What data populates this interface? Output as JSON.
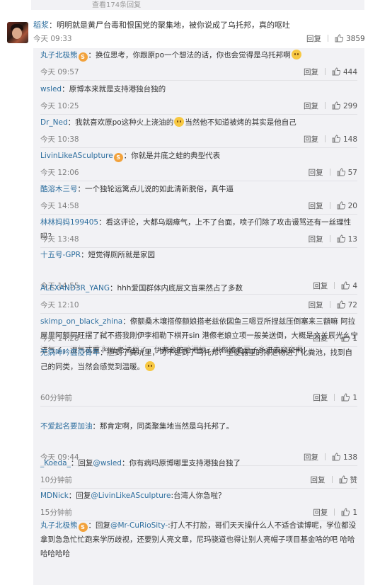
{
  "header": {
    "more_replies": "查看174条回复"
  },
  "main_comment": {
    "username": "稻浆",
    "text": "：明明就是黄尸台毒和恨国党的聚集地，被你说成了乌托邦，真的呕吐",
    "time": "今天 09:33",
    "reply_label": "回复",
    "likes": "3859"
  },
  "replies": [
    {
      "username": "丸子北极熊",
      "badge": "S",
      "text": "：换位思考，你跟原po一个想法的话，你也会觉得是乌托邦啊",
      "emoji_end": true,
      "time": "今天 09:57",
      "reply_label": "回复",
      "likes": "444"
    },
    {
      "username": "wsled",
      "text": "：原博本来就是支持港独台独的",
      "time": "今天 10:25",
      "reply_label": "回复",
      "likes": "299"
    },
    {
      "username": "Dr_Ned",
      "text_a": "：我就喜欢原po这种火上浇油的",
      "text_b": "当然他不知道被烤的其实是他自己",
      "time": "今天 10:38",
      "reply_label": "回复",
      "likes": "148"
    },
    {
      "username": "LivinLikeASculpture",
      "badge": "S",
      "text": "：你就是井底之蛙的典型代表",
      "time": "今天 12:06",
      "reply_label": "回复",
      "likes": "57"
    },
    {
      "username": "酷溶木三号",
      "text": "：一个独轮运篱点儿说的如此清新脱俗，真牛逼",
      "time": "今天 14:58",
      "reply_label": "回复",
      "likes": "20"
    },
    {
      "username": "林林妈妈199405",
      "text": "：看这评论，大都乌烟瘴气，上不了台面，喷子们除了攻击谩骂还有一丝理性吗？",
      "time": "今天 13:48",
      "reply_label": "回复",
      "likes": "13"
    },
    {
      "username": "十五号-GPR",
      "text": "：短觉得厕所就是家园",
      "time": "今天 14:55",
      "reply_label": "回复",
      "likes": "4"
    },
    {
      "username": "ALEXAND3R_YANG",
      "text": "：hhh爱国群体内底层文盲果然占了多数",
      "time": "今天 12:10",
      "reply_label": "回复",
      "likes": "72"
    },
    {
      "username": "skimp_on_black_zhina",
      "text": "：傺额桑木壤搭傺额娘搭老兹依図鱼三嗯豆所捏兹压倒塞来三額嘛 阿拉屋里阿额阿旺摆了弑不搭我刚伊李相勒下棋开sin 港傺老娘立项一般美送倒，大概是文关辰光么宁进气了，湿气忒重 阿旺老法丝了，伊弗会的哈港额。叫傺雅老豆子多进去窥窥啊！",
      "time": "今天 14:28",
      "reply_label": "回复",
      "likes": "1"
    },
    {
      "username": "无病呻吟瘟疫青年",
      "text": "：胆到了粪坑里，可不是到了乌托邦？坐便器里的排泄物进了化粪池，找到自己的同类，当然会感觉到温暖。",
      "emoji_end": true,
      "time": "60分钟前",
      "reply_label": "回复",
      "likes": "1"
    },
    {
      "username": "不爱起名要加油",
      "text": "：那肯定啊，同类聚集地当然是乌托邦了。",
      "time": "今天 09:44",
      "reply_label": "回复",
      "likes": "138"
    },
    {
      "username": "_Koeda_",
      "text_pre": "：回复",
      "at": "@wsled",
      "text": "：你有病吗原博哪里支持港独台独了",
      "time": "10分钟前",
      "reply_label": "回复",
      "likes": "赞"
    },
    {
      "username": "MDNick",
      "text_pre": "：回复",
      "at": "@LivinLikeASculpture",
      "text": ":台湾人你急啦？",
      "time": "15分钟前",
      "reply_label": "回复",
      "likes": "1"
    },
    {
      "username": "丸子北极熊",
      "badge": "S",
      "text_pre": "：回复",
      "at": "@Mr-CuRioSity-",
      "text": ":打人不打脸，哥们天天操什么人不适合读博呢，学位都没拿到急急忙忙跑来学历歧视，还要别人亮文章，尼玛骁道也得让别人亮帽子项目基金啥的吧 哈哈哈哈哈哈",
      "time": "",
      "reply_label": "",
      "likes": ""
    }
  ],
  "icons": {
    "like": "thumbs-up-icon",
    "badge": "vip-badge-icon",
    "emoji": "smile-emoji-icon"
  },
  "colors": {
    "link": "#2d6e9e",
    "muted": "#808080",
    "panel": "#f2f2f5"
  }
}
